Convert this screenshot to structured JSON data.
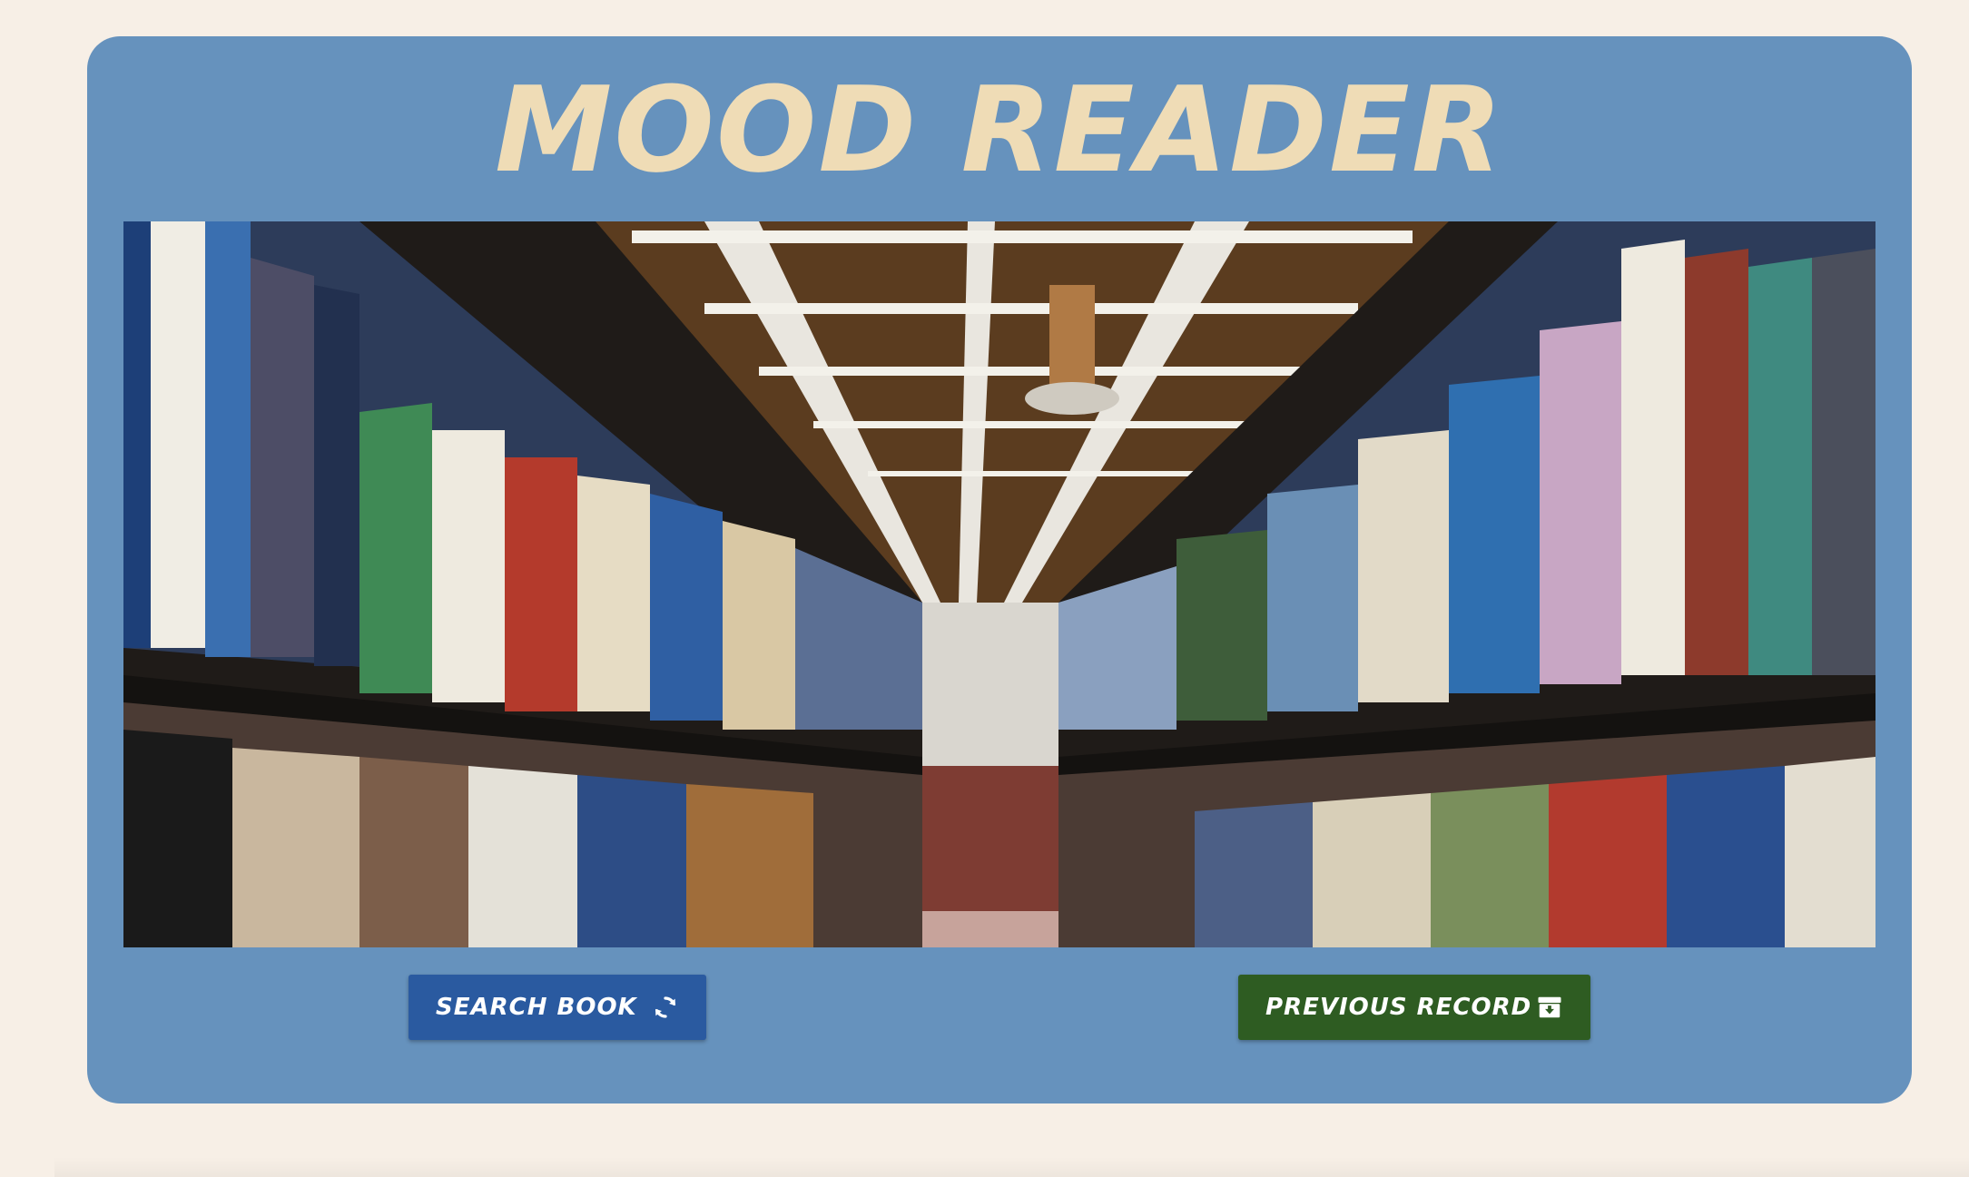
{
  "app": {
    "title": "MOOD READER"
  },
  "hero": {
    "image_subject": "library-bookshelves-aisle"
  },
  "buttons": {
    "search_label": "SEARCH BOOK",
    "search_icon": "refresh-icon",
    "previous_label": "PREVIOUS RECORD",
    "previous_icon": "archive-download-icon"
  },
  "colors": {
    "page_background": "#f7efe6",
    "card_background": "#6692bd",
    "title_color": "#efdcb6",
    "search_button": "#2a5aa0",
    "previous_button": "#2e5c22"
  }
}
